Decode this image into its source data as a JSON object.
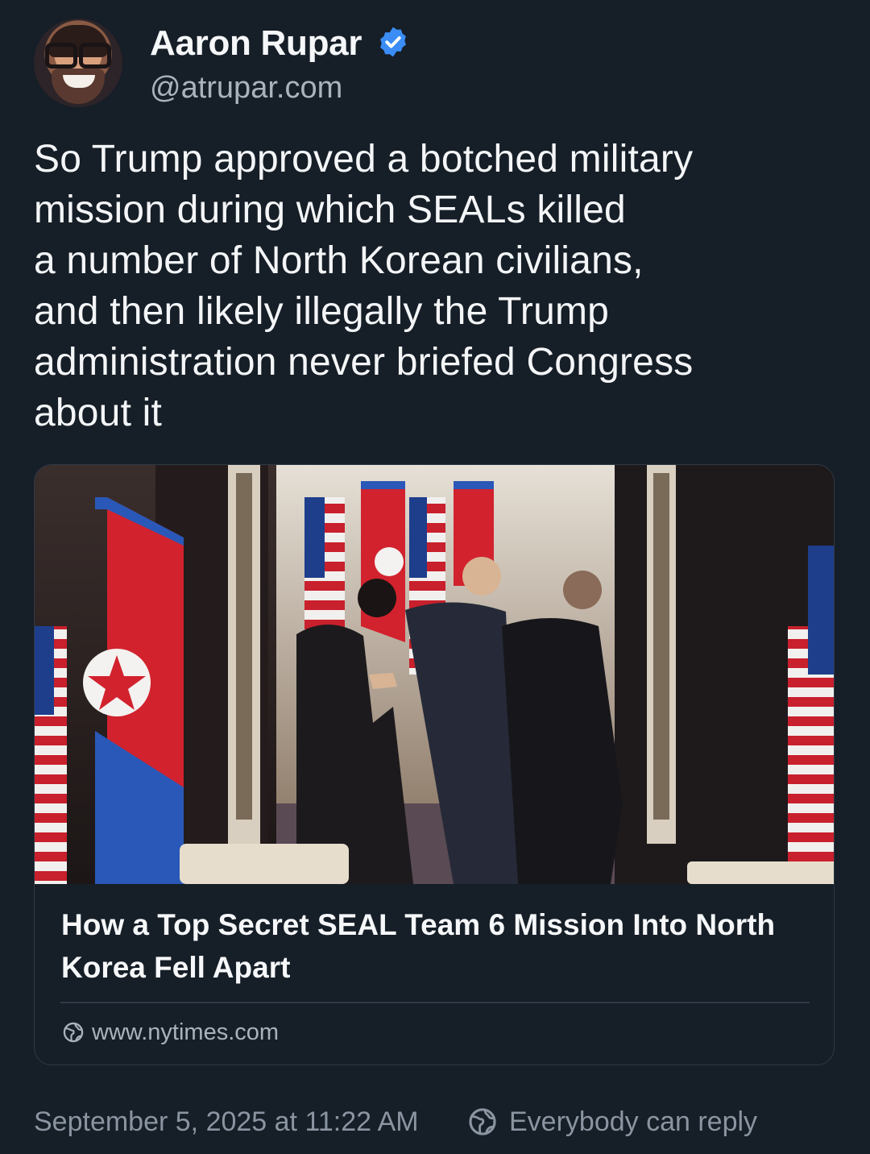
{
  "author": {
    "name": "Aaron Rupar",
    "handle": "@atrupar.com",
    "verified_color": "#3b8df5"
  },
  "post": {
    "text": "So Trump approved a botched military\nmission during which SEALs killed\na number of North Korean civilians,\nand then likely illegally the Trump\nadministration never briefed Congress\nabout it"
  },
  "link_card": {
    "title": "How a Top Secret SEAL Team 6 Mission Into North Korea Fell Apart",
    "domain": "www.nytimes.com",
    "domain_icon": "globe-icon",
    "image_icon": "photo-men-walking-between-flags"
  },
  "footer": {
    "timestamp": "September 5, 2025 at 11:22 AM",
    "reply_setting": "Everybody can reply",
    "reply_icon": "globe-icon"
  },
  "colors": {
    "background": "#161e27",
    "text_primary": "#f1f3f5",
    "text_secondary": "#8a95a1",
    "border": "#2e3a46",
    "accent": "#3b8df5"
  }
}
